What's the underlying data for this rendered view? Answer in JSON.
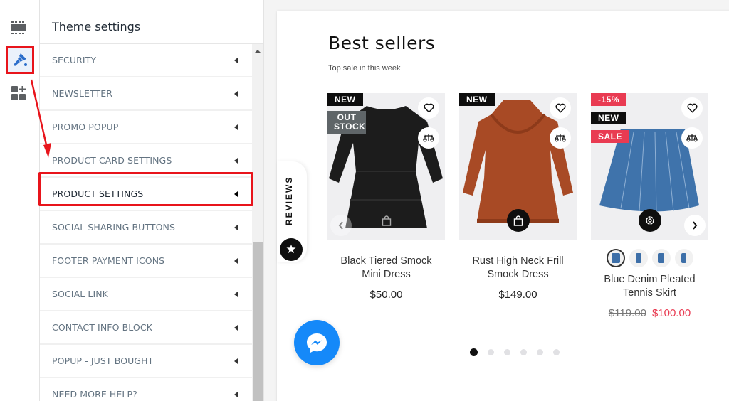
{
  "rail": {
    "items": [
      {
        "icon": "sections-icon",
        "label": "Sections"
      },
      {
        "icon": "theme-settings-brush-icon",
        "label": "Theme settings",
        "active": true
      },
      {
        "icon": "app-embeds-icon",
        "label": "App embeds"
      }
    ]
  },
  "panel": {
    "title": "Theme settings",
    "items": [
      {
        "label": "SECURITY"
      },
      {
        "label": "NEWSLETTER"
      },
      {
        "label": "PROMO POPUP"
      },
      {
        "label": "PRODUCT CARD SETTINGS"
      },
      {
        "label": "PRODUCT SETTINGS",
        "highlighted": true
      },
      {
        "label": "SOCIAL SHARING BUTTONS"
      },
      {
        "label": "FOOTER PAYMENT ICONS"
      },
      {
        "label": "SOCIAL LINK"
      },
      {
        "label": "CONTACT INFO BLOCK"
      },
      {
        "label": "POPUP - JUST BOUGHT"
      },
      {
        "label": "NEED MORE HELP?"
      }
    ]
  },
  "annotation": {
    "color": "#e8141b"
  },
  "preview": {
    "section_title": "Best sellers",
    "section_subtitle": "Top sale in this week",
    "reviews_tab": "REVIEWS",
    "products": [
      {
        "name": "Black Tiered Smock Mini Dress",
        "price": "$50.00",
        "badges": [
          "NEW",
          "OUT STOCK"
        ],
        "image_color": "#1c1c1c",
        "action_icon": "bag-icon"
      },
      {
        "name": "Rust High Neck Frill Smock Dress",
        "price": "$149.00",
        "badges": [
          "NEW"
        ],
        "image_color": "#a84a25",
        "action_icon": "bag-icon"
      },
      {
        "name": "Blue Denim Pleated Tennis Skirt",
        "old_price": "$119.00",
        "sale_price": "$100.00",
        "badges": [
          "-15%",
          "NEW",
          "SALE"
        ],
        "image_color": "#3f73ab",
        "action_icon": "gear-icon",
        "swatch_count": 4
      }
    ],
    "pagination": {
      "total": 6,
      "active": 1
    }
  },
  "colors": {
    "accent_red": "#e93b52",
    "messenger_blue": "#1589f9",
    "brush_blue": "#2c6ecb"
  }
}
